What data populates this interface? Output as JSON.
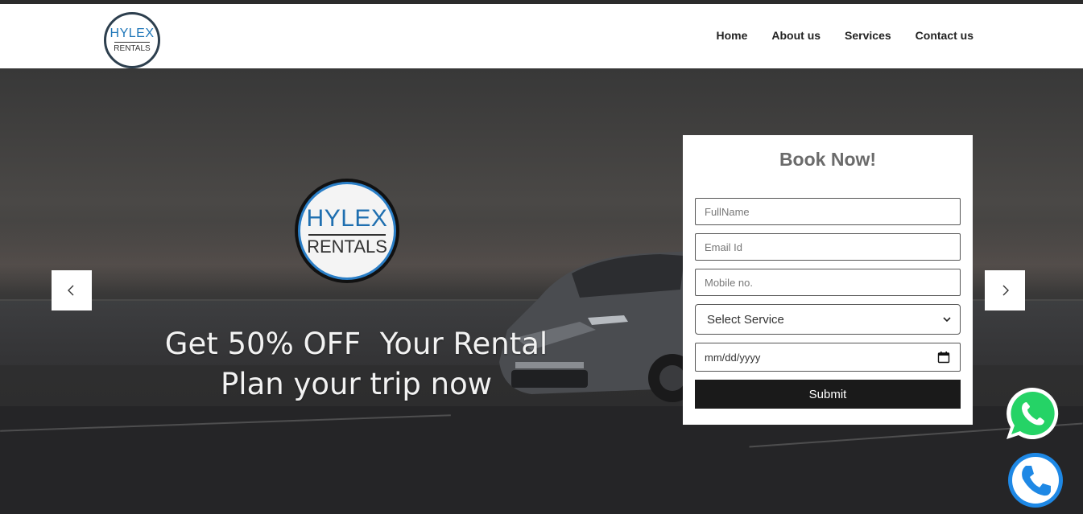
{
  "brand": {
    "logo_line1": "HYLEX",
    "logo_line2": "RENTALS",
    "accent_color": "#1f77b9"
  },
  "nav": {
    "items": [
      "Home",
      "About us",
      "Services",
      "Contact us"
    ]
  },
  "hero": {
    "promo_line1": "Get 50% OFF  Your Rental",
    "promo_line2": "Plan your trip now",
    "prev_icon": "chevron-left-icon",
    "next_icon": "chevron-right-icon"
  },
  "booking": {
    "title": "Book Now!",
    "fullname_placeholder": "FullName",
    "email_placeholder": "Email Id",
    "mobile_placeholder": "Mobile no.",
    "service_selected": "Select Service",
    "date_placeholder": "mm/dd/yyyy",
    "submit_label": "Submit"
  },
  "floating": {
    "whatsapp_icon": "whatsapp-icon",
    "phone_icon": "phone-icon",
    "whatsapp_color": "#25d366",
    "phone_color": "#1e88e5"
  }
}
